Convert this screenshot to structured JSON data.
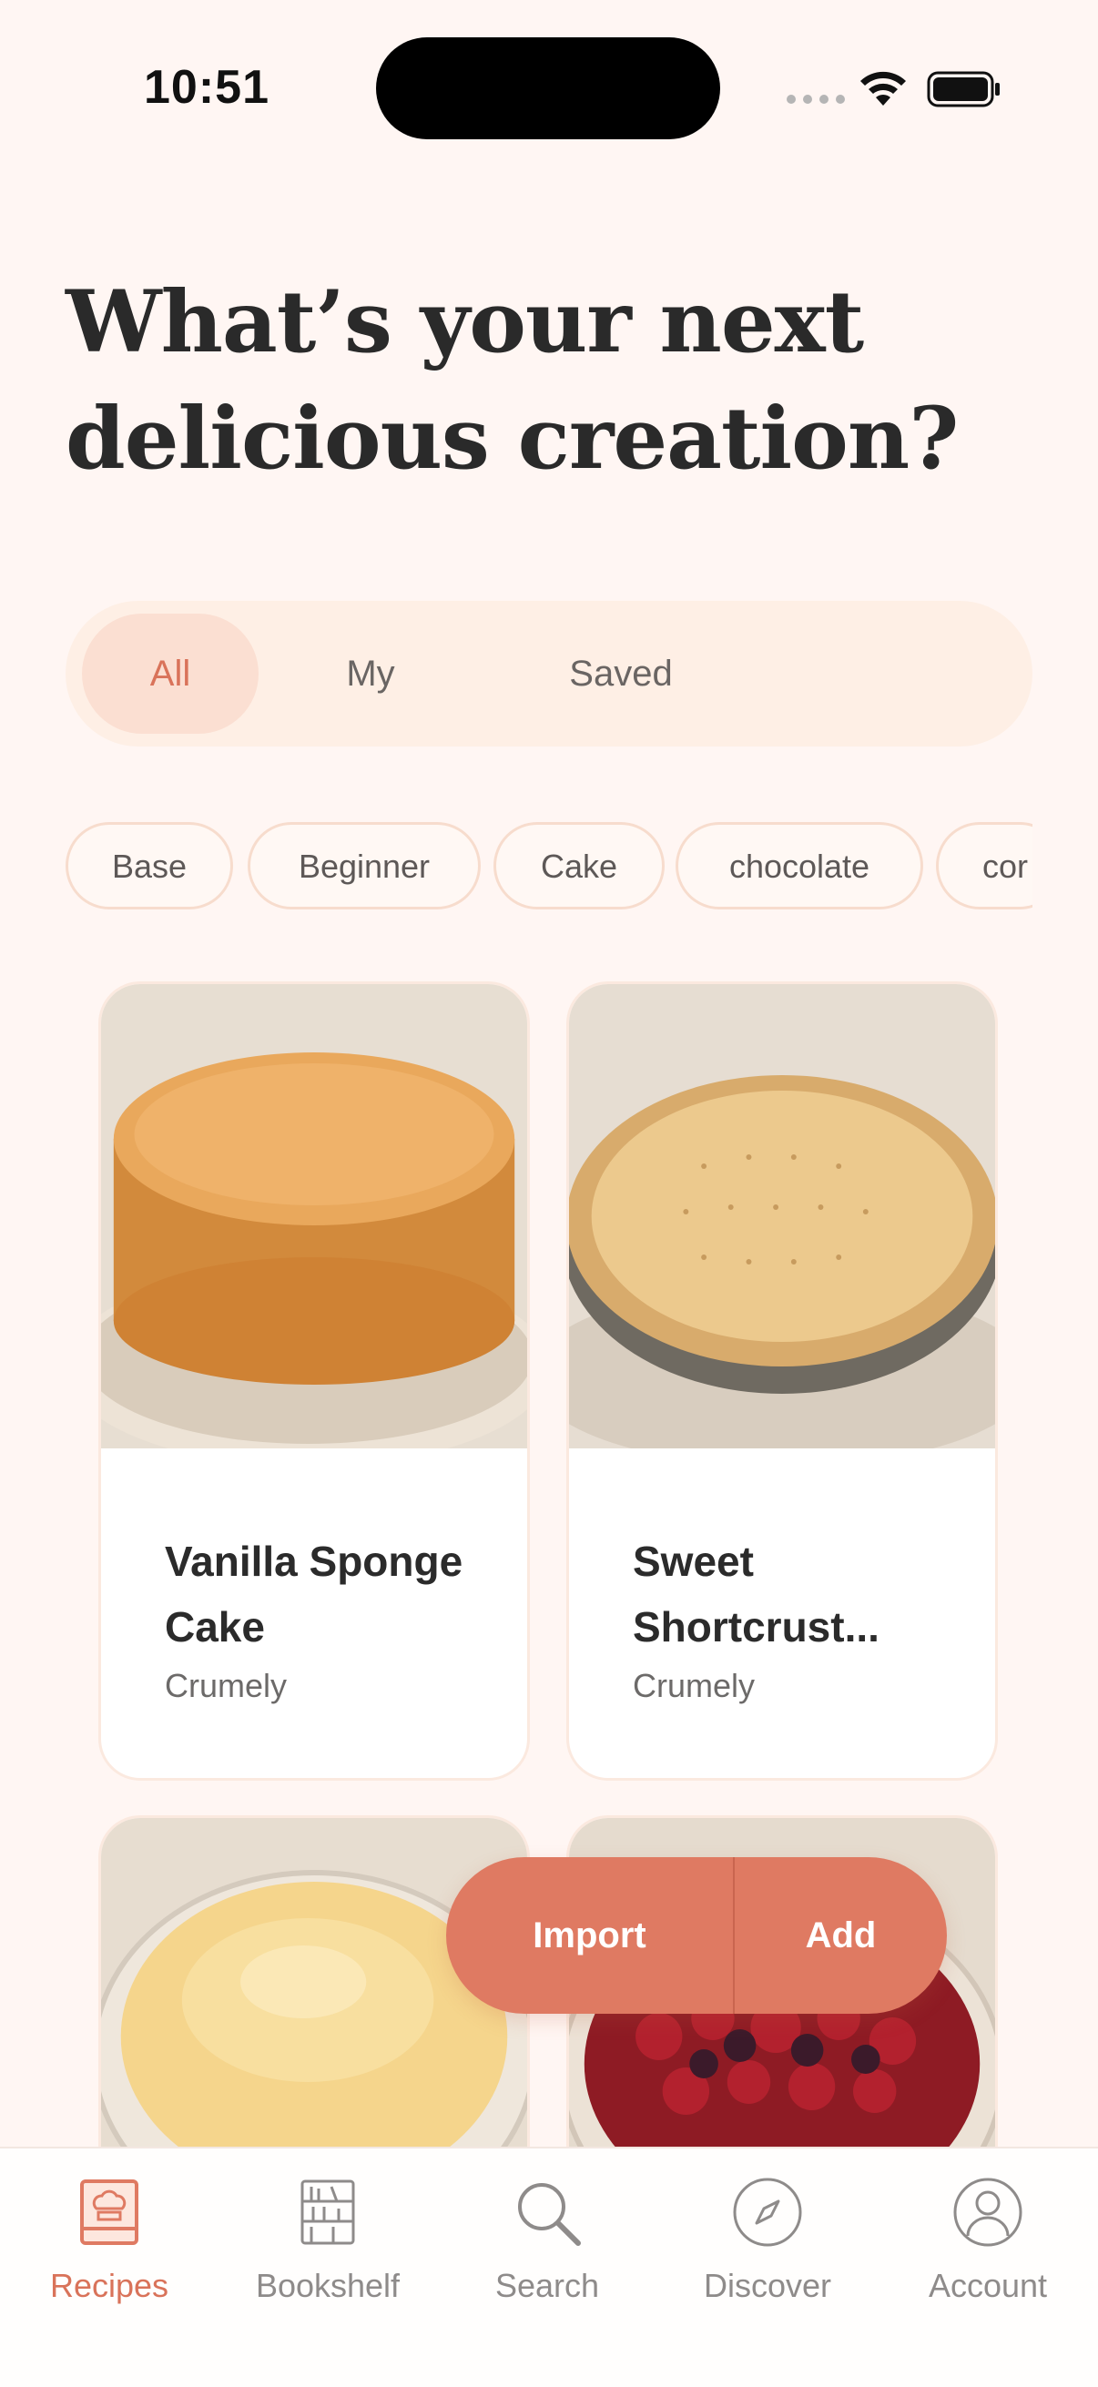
{
  "status_bar": {
    "time": "10:51"
  },
  "header": {
    "title": "What’s your next delicious creation?"
  },
  "segments": {
    "all": "All",
    "my": "My",
    "saved": "Saved",
    "selected": "All"
  },
  "tags": [
    "Base",
    "Beginner",
    "Cake",
    "chocolate",
    "cor"
  ],
  "recipes": [
    {
      "title": "Vanilla Sponge Cake",
      "author": "Crumely",
      "image": "sponge-cake-photo"
    },
    {
      "title": "Sweet Shortcrust...",
      "author": "Crumely",
      "image": "tart-shell-photo"
    },
    {
      "title": "",
      "author": "",
      "image": "custard-bowl-photo"
    },
    {
      "title": "",
      "author": "",
      "image": "berry-compote-photo"
    }
  ],
  "actions": {
    "import": "Import",
    "add": "Add"
  },
  "tabbar": {
    "recipes": "Recipes",
    "bookshelf": "Bookshelf",
    "search": "Search",
    "discover": "Discover",
    "account": "Account",
    "active": "Recipes"
  },
  "colors": {
    "background": "#fff6f3",
    "accent": "#df7a62",
    "accent_text": "#d9735a",
    "segment_bg": "#feefe5",
    "segment_selected": "#fbdfd2"
  }
}
